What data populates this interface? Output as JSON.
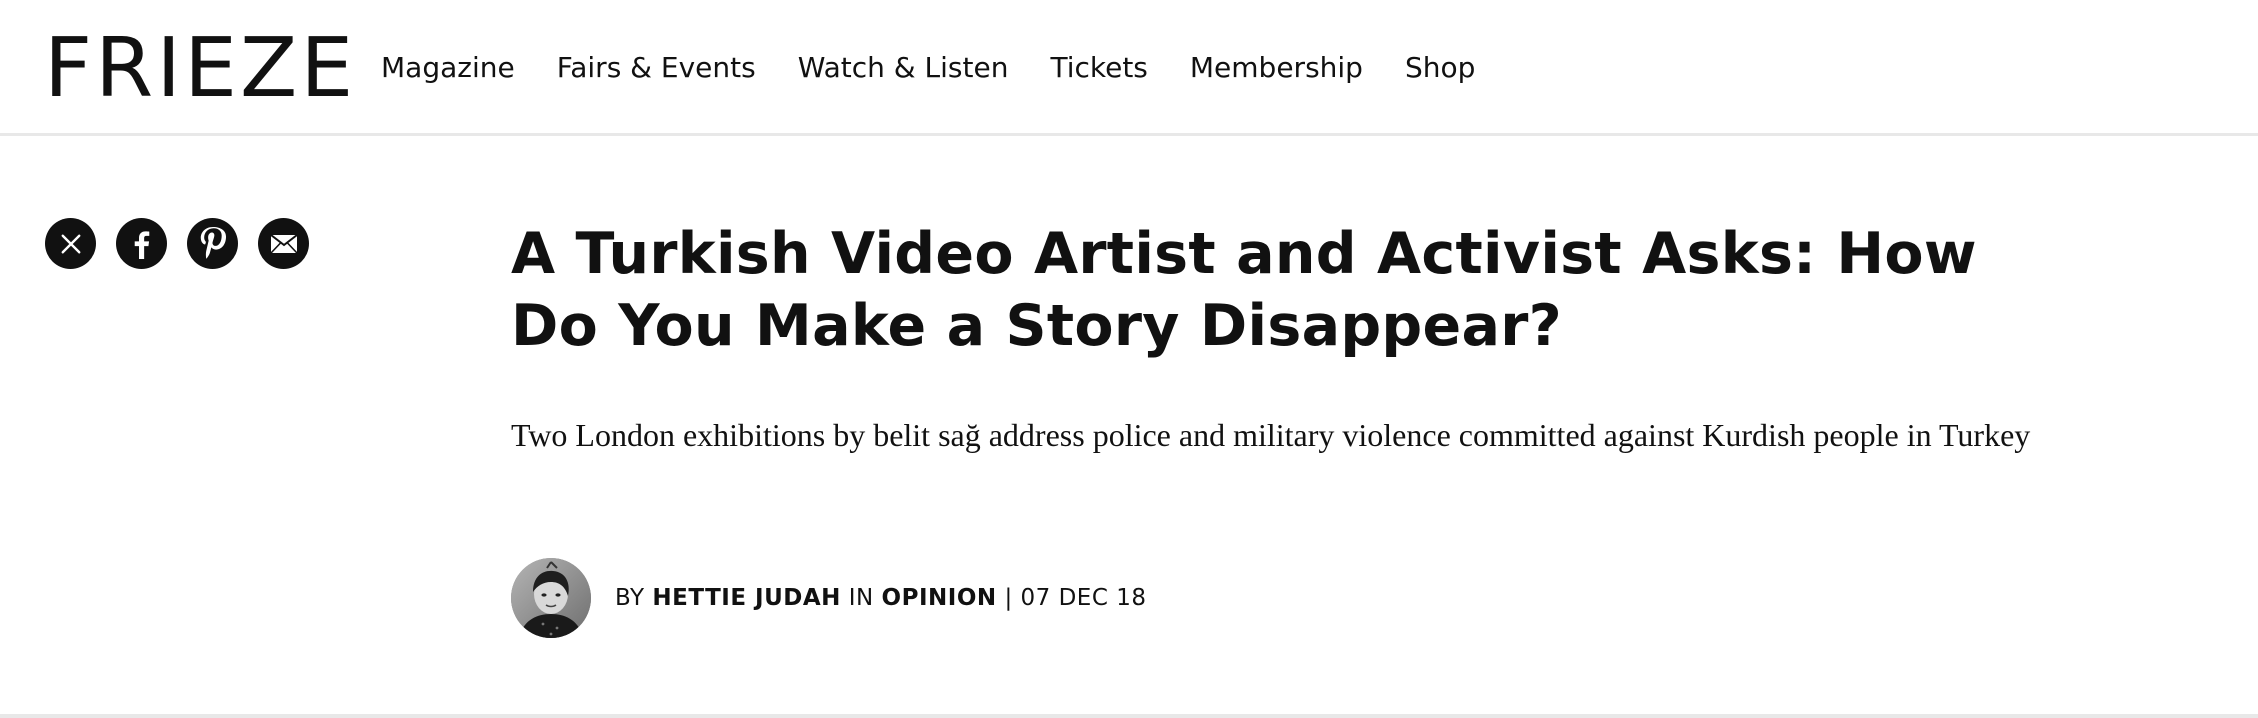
{
  "site": {
    "logo": "FRIEZE"
  },
  "nav": {
    "items": [
      {
        "label": "Magazine"
      },
      {
        "label": "Fairs & Events"
      },
      {
        "label": "Watch & Listen"
      },
      {
        "label": "Tickets"
      },
      {
        "label": "Membership"
      },
      {
        "label": "Shop"
      }
    ]
  },
  "share": {
    "icons": [
      "x-icon",
      "facebook-icon",
      "pinterest-icon",
      "email-icon"
    ]
  },
  "article": {
    "title": "A Turkish Video Artist and Activist Asks: How Do You Make a Story Disappear?",
    "standfirst": "Two London exhibitions by belit sağ address police and military violence committed against Kurdish people in Turkey",
    "byline": {
      "by": "BY",
      "author": "HETTIE JUDAH",
      "in": "IN",
      "section": "OPINION",
      "separator": "|",
      "date": "07 DEC 18"
    }
  },
  "colors": {
    "text": "#111111",
    "divider": "#e8e8e8",
    "background": "#ffffff"
  }
}
